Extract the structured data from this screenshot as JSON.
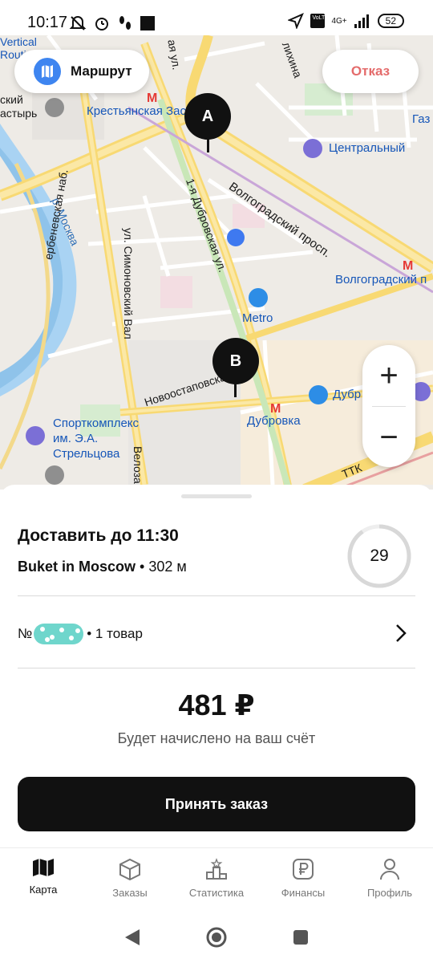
{
  "status_bar": {
    "time": "10:17",
    "battery": "52",
    "network": "4G+",
    "volte": "VoLTE"
  },
  "map": {
    "route_button": "Маршрут",
    "cancel_button": "Отказ",
    "pin_a": "A",
    "pin_b": "B",
    "zoom_in": "+",
    "zoom_out": "−",
    "labels": {
      "krest": "Крестьянская Застава",
      "tsentral": "Центральный",
      "volg_prosp": "Волгоградский просп.",
      "volg_station": "Волгоградский п",
      "dubr_ul": "1-я Дубровская ул.",
      "metro": "Metro",
      "simon": "ул. Симоновский Вал",
      "moskva": "р. Москва",
      "dubrovka": "Дубровка",
      "dubr2": "Дубр",
      "novoost": "Новоостаповская",
      "sport": "Спорткомплекс им. Э.А. Стрельцова",
      "velozav": "Велоза",
      "ttk": "ТТК",
      "vertical": "Vertical Routin",
      "monastyr": "ский астырь",
      "gaz": "Газ",
      "likhina": "лихина",
      "berezh": "ербеневская наб.",
      "ul_a": "ая ул.",
      "k_misc": "щ"
    }
  },
  "order": {
    "deliver_by": "Доставить до 11:30",
    "shop_name": "Buket in Moscow",
    "distance": " • 302 м",
    "timer_value": "29",
    "order_no_prefix": "№",
    "items": "• 1 товар",
    "price": "481 ₽",
    "price_note": "Будет начислено на ваш счёт",
    "accept_button": "Принять заказ"
  },
  "bottom_nav": {
    "items": [
      {
        "label": "Карта",
        "icon": "map-icon",
        "active": true
      },
      {
        "label": "Заказы",
        "icon": "box-icon",
        "active": false
      },
      {
        "label": "Статистика",
        "icon": "podium-icon",
        "active": false
      },
      {
        "label": "Финансы",
        "icon": "ruble-icon",
        "active": false
      },
      {
        "label": "Профиль",
        "icon": "user-icon",
        "active": false
      }
    ]
  }
}
